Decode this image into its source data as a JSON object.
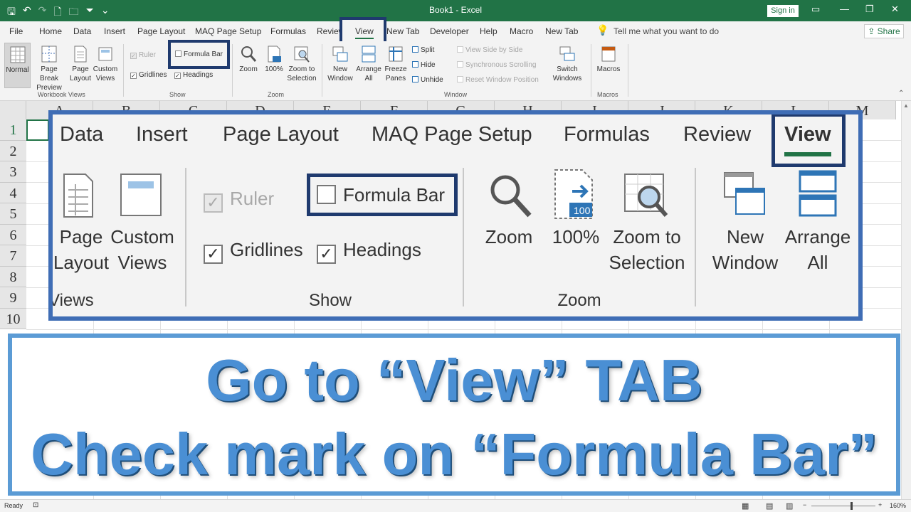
{
  "window": {
    "title": "Book1 - Excel",
    "signin": "Sign in"
  },
  "qat": {
    "save": "🖫",
    "undo": "↶",
    "redo": "↷",
    "new": "🗋",
    "open": "🗀",
    "filter": "⏷",
    "more": "⌄"
  },
  "menu_tabs": [
    "File",
    "Home",
    "Data",
    "Insert",
    "Page Layout",
    "MAQ Page Setup",
    "Formulas",
    "Review",
    "View",
    "New Tab",
    "Developer",
    "Help",
    "Macro",
    "New Tab"
  ],
  "tell_me": "Tell me what you want to do",
  "share": "Share",
  "ribbon": {
    "workbook_views": {
      "label": "Workbook Views",
      "normal": "Normal",
      "page_break": "Page Break Preview",
      "page_layout": "Page Layout",
      "custom_views": "Custom Views"
    },
    "show": {
      "label": "Show",
      "ruler": "Ruler",
      "formula_bar": "Formula Bar",
      "gridlines": "Gridlines",
      "headings": "Headings"
    },
    "zoom": {
      "label": "Zoom",
      "zoom": "Zoom",
      "hundred": "100%",
      "zoom_to_selection": "Zoom to Selection"
    },
    "window": {
      "label": "Window",
      "new_window": "New Window",
      "arrange_all": "Arrange All",
      "freeze_panes": "Freeze Panes",
      "split": "Split",
      "hide": "Hide",
      "unhide": "Unhide",
      "view_side": "View Side by Side",
      "sync_scroll": "Synchronous Scrolling",
      "reset_pos": "Reset Window Position",
      "switch_windows": "Switch Windows"
    },
    "macros": {
      "label": "Macros",
      "macros": "Macros"
    }
  },
  "columns": [
    "A",
    "B",
    "C",
    "D",
    "E",
    "F",
    "G",
    "H",
    "I",
    "J",
    "K",
    "L",
    "M"
  ],
  "rows": [
    "1",
    "2",
    "3",
    "4",
    "5",
    "6",
    "7",
    "8",
    "9",
    "10"
  ],
  "status": {
    "ready": "Ready",
    "zoom": "160%"
  },
  "zoom_overlay": {
    "tabs": [
      "Data",
      "Insert",
      "Page Layout",
      "MAQ Page Setup",
      "Formulas",
      "Review",
      "View"
    ],
    "page_layout": [
      "Page",
      "Layout"
    ],
    "custom_views": [
      "Custom",
      "Views"
    ],
    "views_label": "Views",
    "ruler": "Ruler",
    "formula_bar": "Formula Bar",
    "gridlines": "Gridlines",
    "headings": "Headings",
    "show_label": "Show",
    "zoom": "Zoom",
    "hundred": "100%",
    "zoom_to": [
      "Zoom to",
      "Selection"
    ],
    "zoom_label": "Zoom",
    "new_window": [
      "New",
      "Window"
    ],
    "arrange_all": [
      "Arrange",
      "All"
    ],
    "badge_100": "100"
  },
  "caption": {
    "line1": "Go to “View” TAB",
    "line2": "Check mark on “Formula Bar”"
  },
  "colors": {
    "excel_green": "#217346",
    "highlight_navy": "#1f3a6e",
    "overlay_border": "#3f6db5",
    "caption_blue": "#4a8fd4"
  }
}
